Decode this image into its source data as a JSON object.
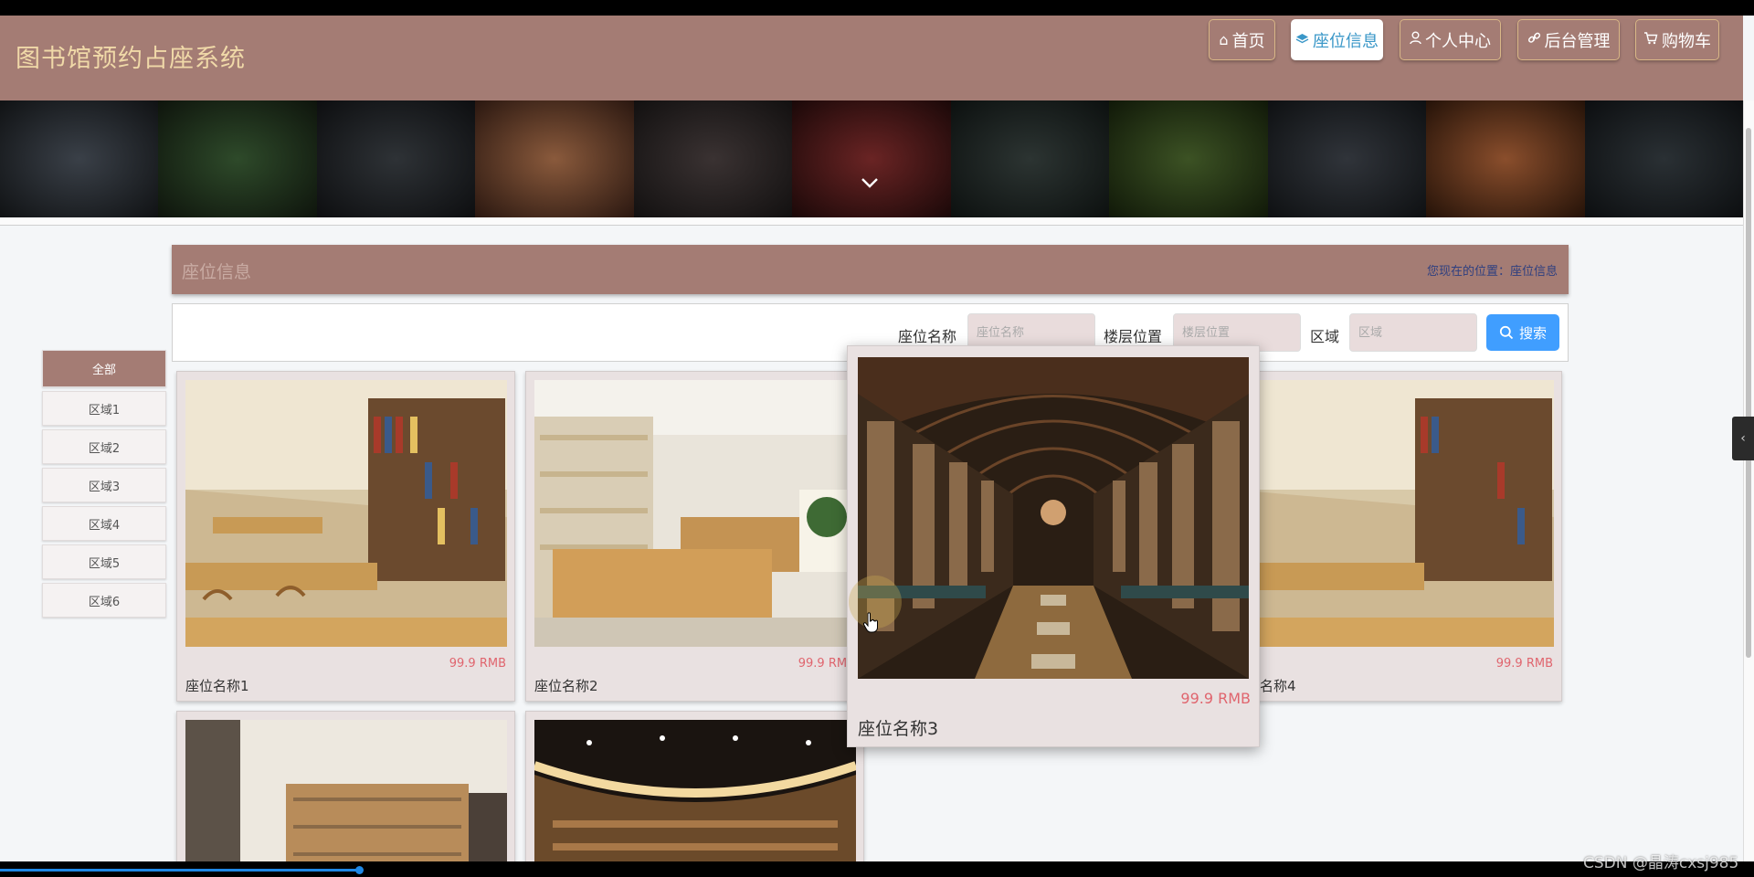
{
  "header": {
    "site_title": "图书馆预约占座系统",
    "nav": [
      {
        "label": "首页",
        "icon": "home-icon"
      },
      {
        "label": "座位信息",
        "icon": "layers-icon",
        "active": true
      },
      {
        "label": "个人中心",
        "icon": "user-icon"
      },
      {
        "label": "后台管理",
        "icon": "link-icon"
      },
      {
        "label": "购物车",
        "icon": "cart-icon"
      }
    ]
  },
  "breadcrumb": {
    "title": "座位信息",
    "location_prefix": "您现在的位置：",
    "location_current": "座位信息"
  },
  "search": {
    "fields": [
      {
        "label": "座位名称",
        "placeholder": "座位名称"
      },
      {
        "label": "楼层位置",
        "placeholder": "楼层位置"
      },
      {
        "label": "区域",
        "placeholder": "区域"
      }
    ],
    "button_label": "搜索"
  },
  "categories": [
    "全部",
    "区域1",
    "区域2",
    "区域3",
    "区域4",
    "区域5",
    "区域6"
  ],
  "cards": [
    {
      "name": "座位名称1",
      "price": "99.9 RMB"
    },
    {
      "name": "座位名称2",
      "price": "99.9 RMB"
    },
    {
      "name": "座位名称3",
      "price": "99.9 RMB"
    },
    {
      "name": "座位名称4",
      "price": "99.9 RMB"
    }
  ],
  "card4_visible_name": "称4",
  "watermark": "CSDN @晶涛cxsj985",
  "colors": {
    "primary": "#a47c74",
    "title_gold": "#f0d9a8",
    "price_red": "#e0656e",
    "search_blue": "#409eff",
    "active_nav_text": "#3a97c8"
  }
}
